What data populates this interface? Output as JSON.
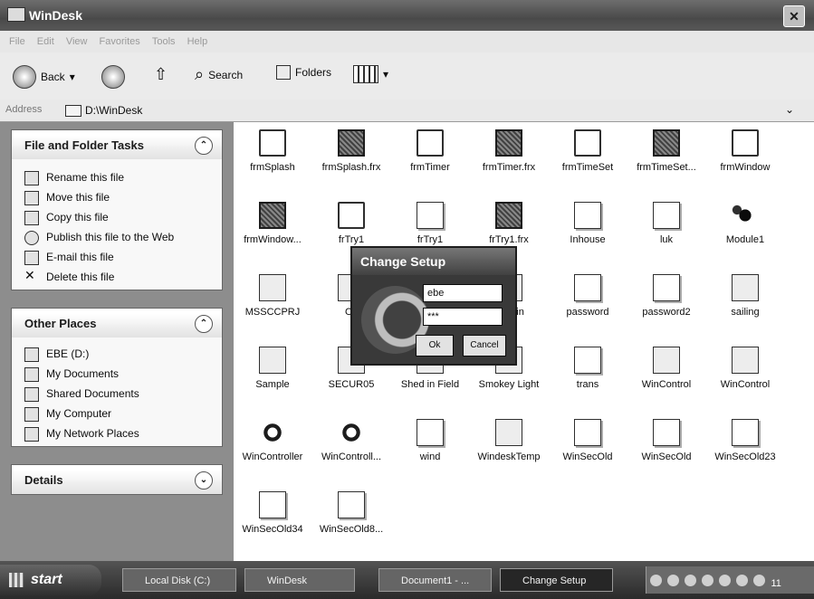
{
  "window": {
    "title": "WinDesk"
  },
  "menu": [
    "File",
    "Edit",
    "View",
    "Favorites",
    "Tools",
    "Help"
  ],
  "toolbar": {
    "back": "Back",
    "search": "Search",
    "folders": "Folders"
  },
  "address": {
    "label": "Address",
    "path": "D:\\WinDesk"
  },
  "file_tasks": {
    "title": "File and Folder Tasks",
    "items": [
      "Rename this file",
      "Move this file",
      "Copy this file",
      "Publish this file to the Web",
      "E-mail this file",
      "Delete this file"
    ]
  },
  "other_places": {
    "title": "Other Places",
    "items": [
      "EBE (D:)",
      "My Documents",
      "Shared Documents",
      "My Computer",
      "My Network Places"
    ]
  },
  "details": {
    "title": "Details"
  },
  "files": [
    {
      "name": "frmSplash",
      "icon": "folder-icon"
    },
    {
      "name": "frmSplash.frx",
      "icon": "form-icon"
    },
    {
      "name": "frmTimer",
      "icon": "folder-icon"
    },
    {
      "name": "frmTimer.frx",
      "icon": "form-icon"
    },
    {
      "name": "frmTimeSet",
      "icon": "folder-icon"
    },
    {
      "name": "frmTimeSet...",
      "icon": "form-icon"
    },
    {
      "name": "frmWindow",
      "icon": "folder-icon"
    },
    {
      "name": "frmWindow...",
      "icon": "form-icon"
    },
    {
      "name": "frTry1",
      "icon": "folder-icon"
    },
    {
      "name": "frTry1",
      "icon": "doc-icon"
    },
    {
      "name": "frTry1.frx",
      "icon": "form-icon"
    },
    {
      "name": "Inhouse",
      "icon": "doc-icon"
    },
    {
      "name": "luk",
      "icon": "doc-icon"
    },
    {
      "name": "Module1",
      "icon": "module-icon"
    },
    {
      "name": "MSSCCPRJ",
      "icon": "program-icon"
    },
    {
      "name": "Oc",
      "icon": "program-icon"
    },
    {
      "name": "",
      "icon": "program-icon"
    },
    {
      "name": "remain",
      "icon": "program-icon"
    },
    {
      "name": "password",
      "icon": "doc-icon"
    },
    {
      "name": "password2",
      "icon": "doc-icon"
    },
    {
      "name": "sailing",
      "icon": "program-icon"
    },
    {
      "name": "Sample",
      "icon": "program-icon"
    },
    {
      "name": "SECUR05",
      "icon": "program-icon"
    },
    {
      "name": "Shed in Field",
      "icon": "program-icon"
    },
    {
      "name": "Smokey Light",
      "icon": "program-icon"
    },
    {
      "name": "trans",
      "icon": "doc-icon"
    },
    {
      "name": "WinControl",
      "icon": "network-icon"
    },
    {
      "name": "WinControl",
      "icon": "program-icon"
    },
    {
      "name": "WinController",
      "icon": "gear-icon"
    },
    {
      "name": "WinControll...",
      "icon": "gear-icon"
    },
    {
      "name": "wind",
      "icon": "doc-icon"
    },
    {
      "name": "WindeskTemp",
      "icon": "program-icon"
    },
    {
      "name": "WinSecOld",
      "icon": "doc-icon"
    },
    {
      "name": "WinSecOld",
      "icon": "doc-icon"
    },
    {
      "name": "WinSecOld23",
      "icon": "doc-icon"
    },
    {
      "name": "WinSecOld34",
      "icon": "doc-icon"
    },
    {
      "name": "WinSecOld8...",
      "icon": "doc-icon"
    }
  ],
  "dialog": {
    "title": "Change Setup",
    "username": "ebe",
    "password": "***",
    "ok": "Ok",
    "cancel": "Cancel"
  },
  "taskbar": {
    "start": "start",
    "buttons": [
      "Local Disk (C:)",
      "WinDesk",
      "Document1 - ...",
      "Change Setup"
    ],
    "clock": "11"
  }
}
